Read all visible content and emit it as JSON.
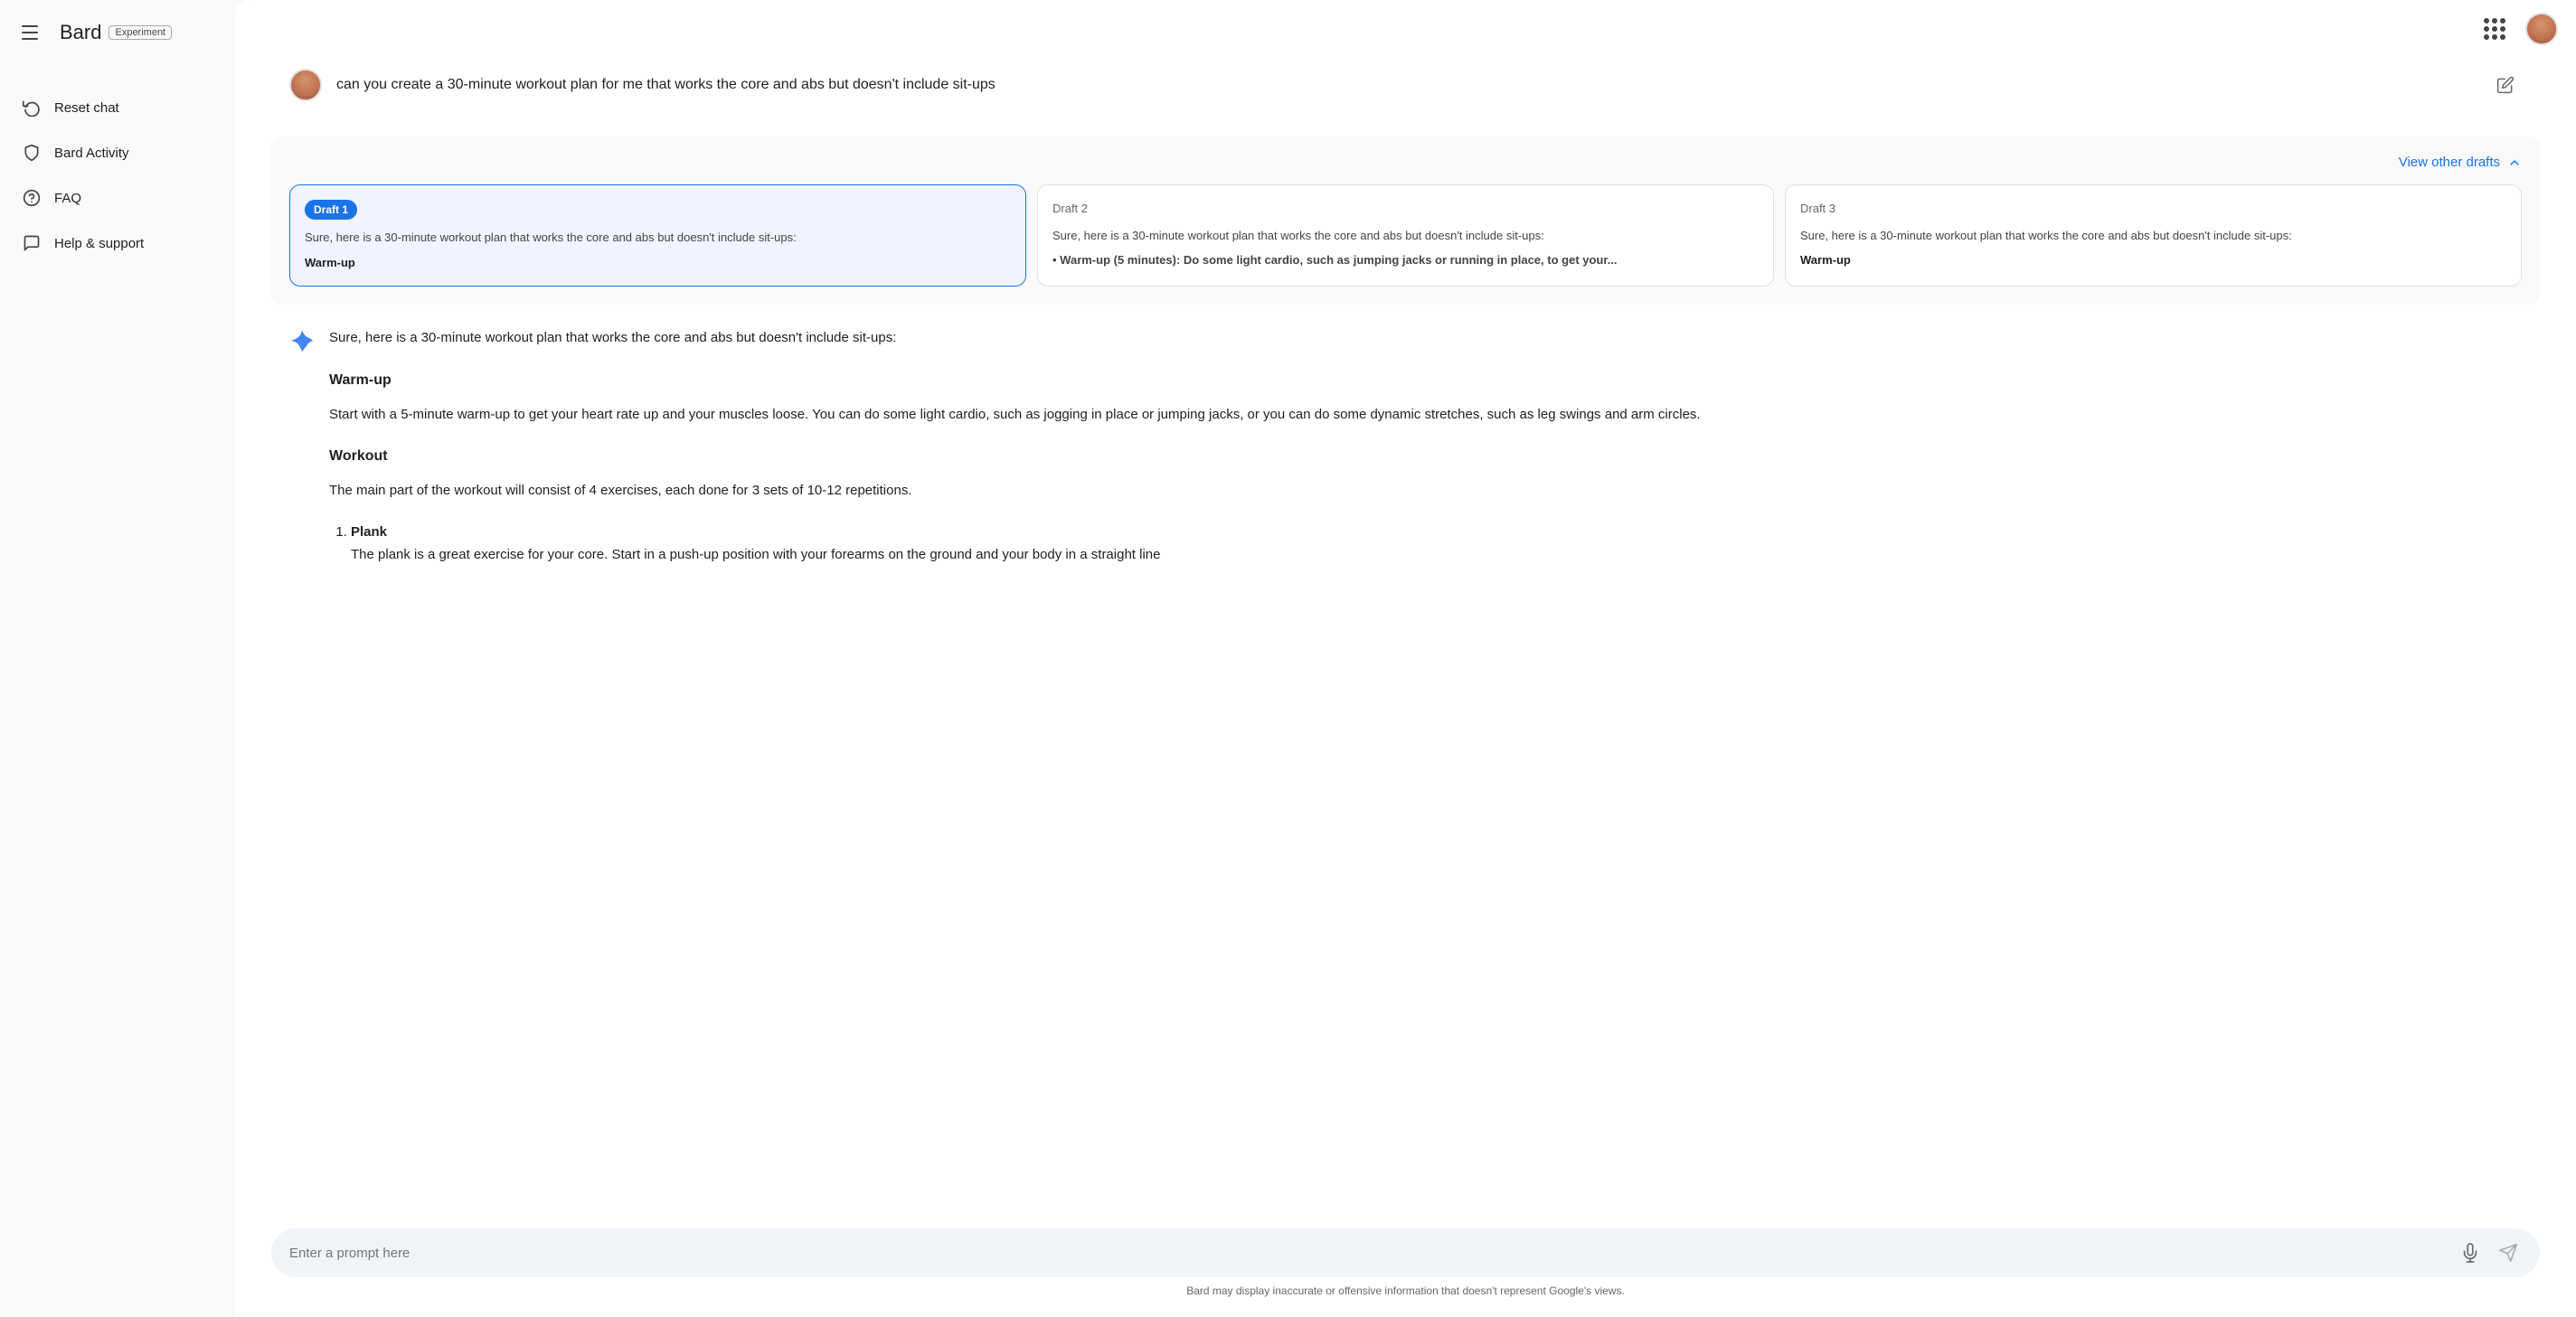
{
  "sidebar": {
    "title": "Bard",
    "badge": "Experiment",
    "nav_items": [
      {
        "id": "reset-chat",
        "label": "Reset chat",
        "icon": "reset"
      },
      {
        "id": "bard-activity",
        "label": "Bard Activity",
        "icon": "shield"
      },
      {
        "id": "faq",
        "label": "FAQ",
        "icon": "question"
      },
      {
        "id": "help-support",
        "label": "Help & support",
        "icon": "help"
      }
    ]
  },
  "user_query": "can you create a 30-minute workout plan for me that works the core and abs but doesn't include sit-ups",
  "drafts": {
    "view_label": "View other drafts",
    "items": [
      {
        "id": "draft-1",
        "label": "Draft 1",
        "active": true,
        "text": "Sure, here is a 30-minute workout plan that works the core and abs but doesn't include sit-ups:",
        "sub": "Warm-up"
      },
      {
        "id": "draft-2",
        "label": "Draft 2",
        "active": false,
        "text": "Sure, here is a 30-minute workout plan that works the core and abs but doesn't include sit-ups:",
        "sub": "Warm-up (5 minutes): Do some light cardio, such as jumping jacks or running in place, to get your..."
      },
      {
        "id": "draft-3",
        "label": "Draft 3",
        "active": false,
        "text": "Sure, here is a 30-minute workout plan that works the core and abs but doesn't include sit-ups:",
        "sub": "Warm-up"
      }
    ]
  },
  "response": {
    "intro": "Sure, here is a 30-minute workout plan that works the core and abs but doesn't include sit-ups:",
    "sections": [
      {
        "title": "Warm-up",
        "content": "Start with a 5-minute warm-up to get your heart rate up and your muscles loose. You can do some light cardio, such as jogging in place or jumping jacks, or you can do some dynamic stretches, such as leg swings and arm circles."
      },
      {
        "title": "Workout",
        "content": "The main part of the workout will consist of 4 exercises, each done for 3 sets of 10-12 repetitions."
      }
    ],
    "exercise_list": [
      {
        "number": "1.",
        "name": "Plank",
        "description": "The plank is a great exercise for your core. Start in a push-up position with your forearms on the ground and your body in a straight line"
      }
    ]
  },
  "input": {
    "placeholder": "Enter a prompt here"
  },
  "disclaimer": "Bard may display inaccurate or offensive information that doesn't represent Google's views.",
  "icons": {
    "hamburger": "☰",
    "reset": "↺",
    "shield": "🛡",
    "question": "?",
    "help": "💬",
    "edit": "✎",
    "chevron_up": "∧",
    "mic": "🎤",
    "send": "▷"
  }
}
